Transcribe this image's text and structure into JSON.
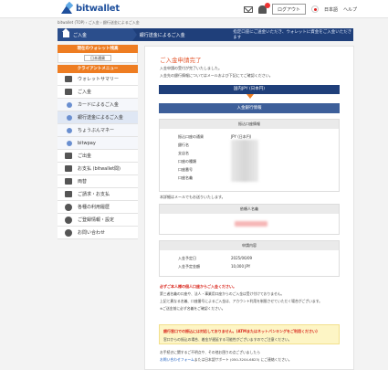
{
  "header": {
    "logo_text": "bitwallet",
    "logout_label": "ログアウト",
    "language": "日本語",
    "help": "ヘルプ"
  },
  "breadcrumb": "bitwallet (TOP)  ›  ご入金  ›  銀行送金によるご入金",
  "titlebar": {
    "home_label": "ご入金",
    "current": "銀行送金によるご入金",
    "note": "指定口座にご送金いただき、ウォレットに資金をご入金いただきます"
  },
  "sidebar": {
    "wallet_title": "現在のウォレット残高",
    "wallet_select": "日本通貨",
    "menu_title": "クライアントメニュー",
    "items": [
      {
        "label": "ウォレットサマリー",
        "icon": "wallet-icon",
        "type": "top"
      },
      {
        "label": "ご入金",
        "icon": "deposit-icon",
        "type": "top"
      },
      {
        "label": "カードによるご入金",
        "icon": "card-icon",
        "type": "sub"
      },
      {
        "label": "銀行送金によるご入金",
        "icon": "bank-icon",
        "type": "sub"
      },
      {
        "label": "ちょうぶんマネー",
        "icon": "money-icon",
        "type": "sub"
      },
      {
        "label": "bitwpay",
        "icon": "pay-icon",
        "type": "sub"
      },
      {
        "label": "ご出金",
        "icon": "withdraw-icon",
        "type": "top"
      },
      {
        "label": "お支払 (bitwallet間)",
        "icon": "transfer-icon",
        "type": "top"
      },
      {
        "label": "両替",
        "icon": "exchange-icon",
        "type": "top"
      },
      {
        "label": "ご請求・お支払",
        "icon": "invoice-icon",
        "type": "top"
      },
      {
        "label": "各種の利用履歴",
        "icon": "history-icon",
        "type": "top"
      },
      {
        "label": "ご登録情報・設定",
        "icon": "settings-icon",
        "type": "top"
      },
      {
        "label": "お問い合わせ",
        "icon": "contact-icon",
        "type": "top"
      }
    ]
  },
  "main": {
    "title": "ご入金申請完了",
    "intro1": "入金申請の受付が完了いたしました。",
    "intro2": "入金先の銀行情報についてはメールおよび下記にてご確認ください。",
    "currency_bar": "国内JPY (日本円)",
    "bank_bar": "入金銀行情報",
    "bank_box_head": "振込口座情報",
    "bank_rows": [
      {
        "label": "振込口座の通貨",
        "value": "JPY (日本円)"
      },
      {
        "label": "銀行名",
        "value": ""
      },
      {
        "label": "支店名",
        "value": ""
      },
      {
        "label": "口座の種類",
        "value": ""
      },
      {
        "label": "口座番号",
        "value": ""
      },
      {
        "label": "口座名義",
        "value": ""
      }
    ],
    "mail_note": "本詳細はメールでもお送りいたします。",
    "sender_box_head": "依頼人名義",
    "request_box_head": "申請内容",
    "request_rows": [
      {
        "label": "入金予定日",
        "value": "2025/06/09"
      },
      {
        "label": "入金予定金額",
        "value": "10,000 JPY"
      }
    ],
    "warn_title": "必ずご本人様の個人口座からご入金ください。",
    "warn_lines": [
      "第三者名義の口座や、法人・事業用口座からのご入金は受け付けておりません。",
      "上記と異なる名義、口座番号によるご入金は、アカウント利用を制限させていただく場合がございます。",
      "※ご送金前に必ず名義をご確認ください。"
    ],
    "yellow_title": "銀行窓口での振込には対応しておりません。(ATMまたはネットバンキングをご利用ください)",
    "yellow_line": "窓口からの振込の場合、着金が遅延する可能性がございますのでご注意ください。",
    "footer1": "お手続きに関するご不明点や、その他お困りの点ございましたら",
    "footer_link": "お問い合わせフォーム",
    "footer2": "または日本語サポート (050-3204-6823) にご連絡ください。"
  }
}
